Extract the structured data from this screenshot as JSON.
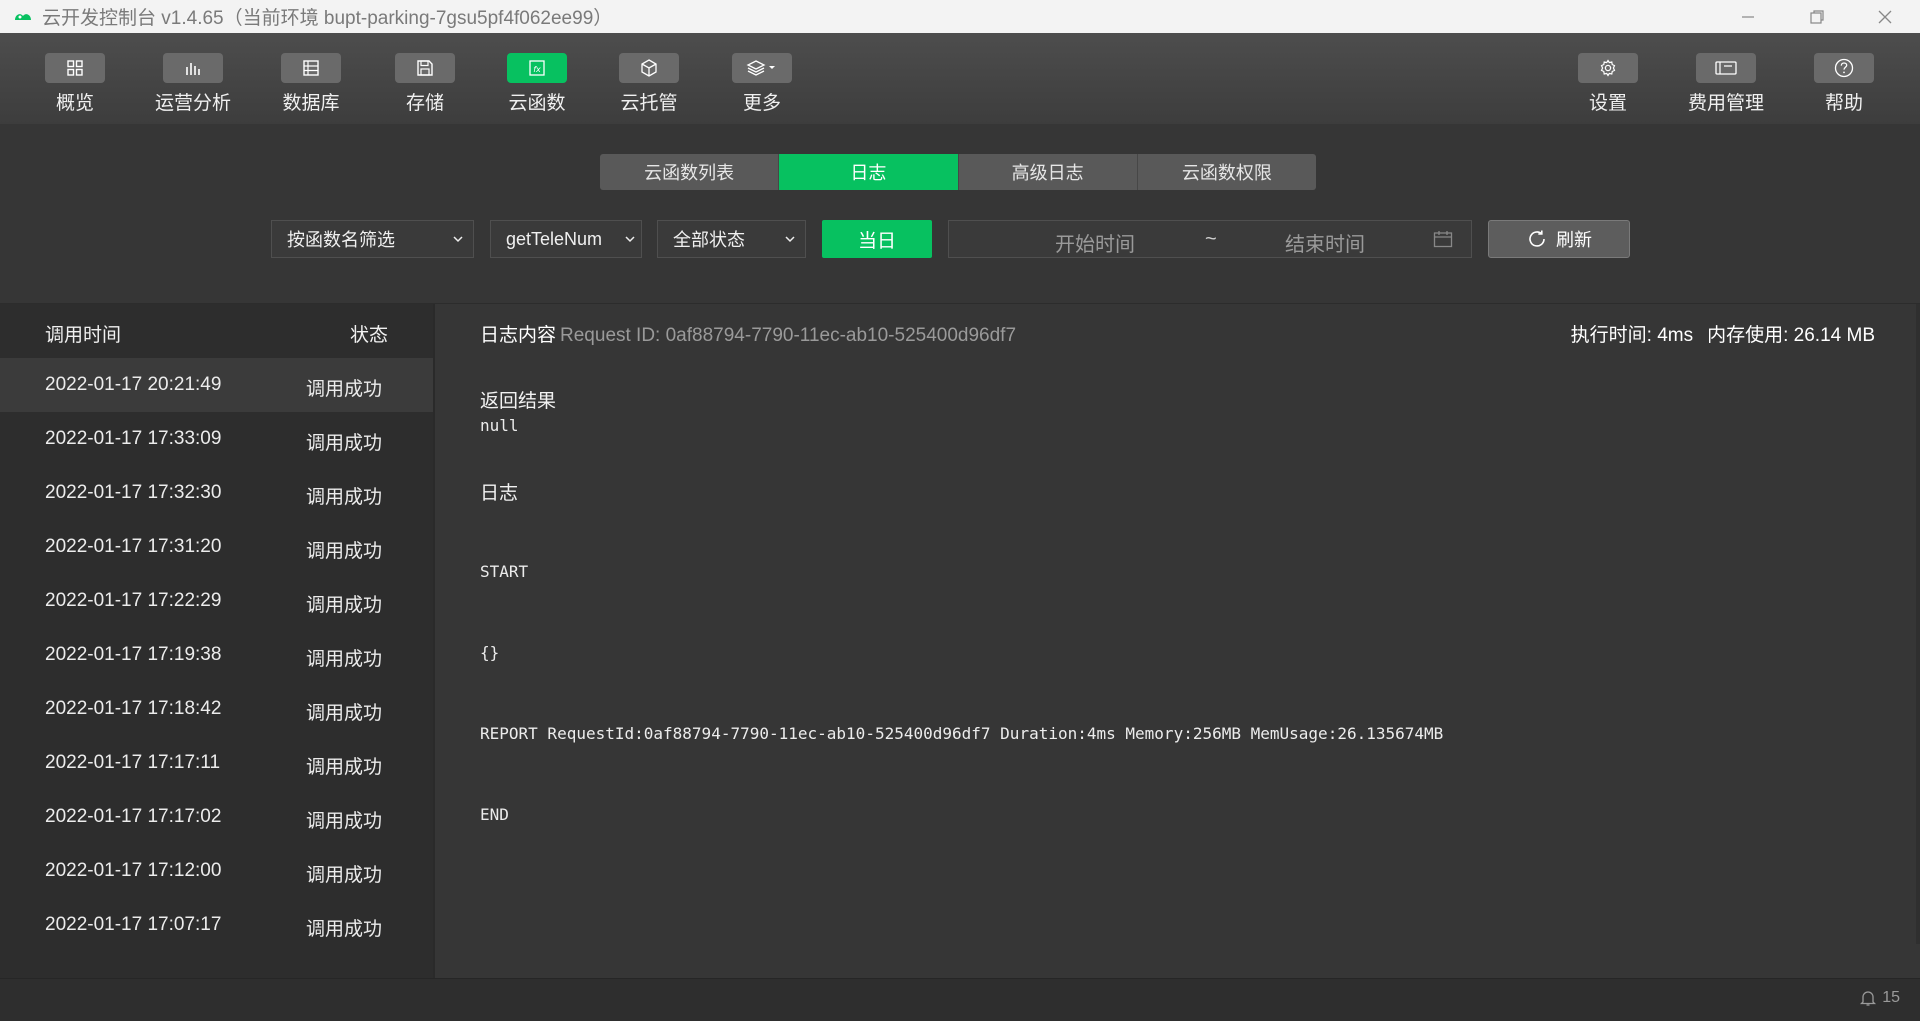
{
  "window": {
    "title": "云开发控制台 v1.4.65（当前环境 bupt-parking-7gsu5pf4f062ee99）"
  },
  "toolbar": {
    "items": [
      {
        "label": "概览",
        "icon": "overview-grid-icon"
      },
      {
        "label": "运营分析",
        "icon": "bar-chart-icon"
      },
      {
        "label": "数据库",
        "icon": "database-icon"
      },
      {
        "label": "存储",
        "icon": "save-disk-icon"
      },
      {
        "label": "云函数",
        "icon": "function-fx-icon",
        "active": true
      },
      {
        "label": "云托管",
        "icon": "cube-icon"
      },
      {
        "label": "更多",
        "icon": "layers-dropdown-icon"
      }
    ],
    "right_items": [
      {
        "label": "设置",
        "icon": "gear-icon"
      },
      {
        "label": "费用管理",
        "icon": "billing-icon"
      },
      {
        "label": "帮助",
        "icon": "help-circle-icon"
      }
    ]
  },
  "tabs": [
    {
      "label": "云函数列表"
    },
    {
      "label": "日志",
      "active": true
    },
    {
      "label": "高级日志"
    },
    {
      "label": "云函数权限"
    }
  ],
  "filters": {
    "filter_mode": "按函数名筛选",
    "function_name": "getTeleNum",
    "status": "全部状态",
    "today": "当日",
    "start_placeholder": "开始时间",
    "separator": "~",
    "end_placeholder": "结束时间",
    "refresh": "刷新"
  },
  "invocations": {
    "header_time": "调用时间",
    "header_status": "状态",
    "rows": [
      {
        "time": "2022-01-17 20:21:49",
        "status": "调用成功"
      },
      {
        "time": "2022-01-17 17:33:09",
        "status": "调用成功"
      },
      {
        "time": "2022-01-17 17:32:30",
        "status": "调用成功"
      },
      {
        "time": "2022-01-17 17:31:20",
        "status": "调用成功"
      },
      {
        "time": "2022-01-17 17:22:29",
        "status": "调用成功"
      },
      {
        "time": "2022-01-17 17:19:38",
        "status": "调用成功"
      },
      {
        "time": "2022-01-17 17:18:42",
        "status": "调用成功"
      },
      {
        "time": "2022-01-17 17:17:11",
        "status": "调用成功"
      },
      {
        "time": "2022-01-17 17:17:02",
        "status": "调用成功"
      },
      {
        "time": "2022-01-17 17:12:00",
        "status": "调用成功"
      },
      {
        "time": "2022-01-17 17:07:17",
        "status": "调用成功"
      }
    ]
  },
  "log": {
    "title": "日志内容",
    "request_id": "Request ID: 0af88794-7790-11ec-ab10-525400d96df7",
    "exec_time": "执行时间: 4ms",
    "memory": "内存使用: 26.14 MB",
    "result_title": "返回结果",
    "result_value": "null",
    "log_title": "日志",
    "lines": [
      "START",
      "{}",
      "REPORT RequestId:0af88794-7790-11ec-ab10-525400d96df7 Duration:4ms Memory:256MB MemUsage:26.135674MB",
      "END"
    ]
  },
  "status_bar": {
    "notification_count": "15"
  },
  "colors": {
    "accent": "#07c160",
    "background": "#363636",
    "list_background": "#2d2d2d"
  }
}
